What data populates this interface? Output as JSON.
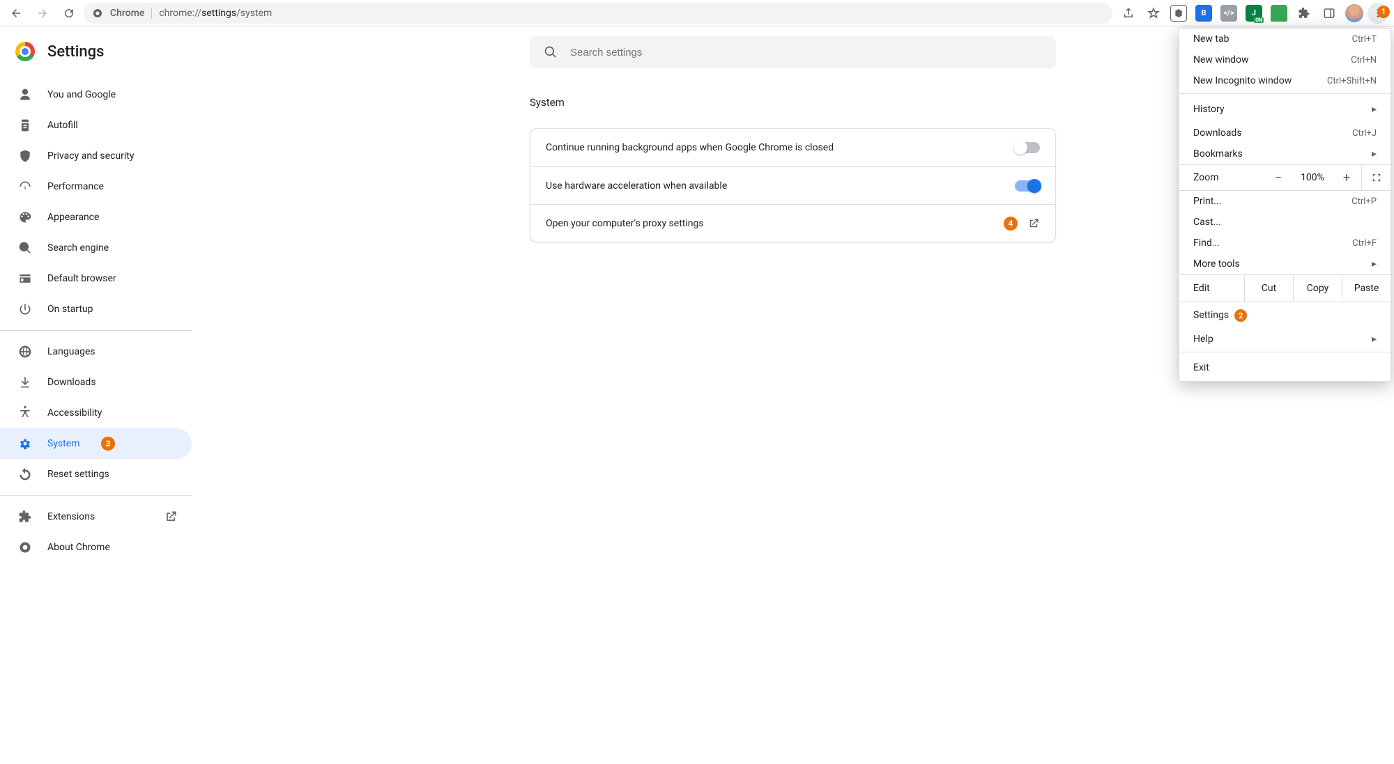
{
  "toolbar": {
    "page_label": "Chrome",
    "url_full": "chrome://settings/system",
    "url_dim_prefix": "chrome://",
    "url_dim_suffix": "/system",
    "url_bold": "settings"
  },
  "kebab_badge": "1",
  "app": {
    "title": "Settings"
  },
  "search": {
    "placeholder": "Search settings"
  },
  "sidebar": {
    "groups": [
      [
        "You and Google",
        "Autofill",
        "Privacy and security",
        "Performance",
        "Appearance",
        "Search engine",
        "Default browser",
        "On startup"
      ],
      [
        "Languages",
        "Downloads",
        "Accessibility",
        "System",
        "Reset settings"
      ],
      [
        "Extensions",
        "About Chrome"
      ]
    ],
    "selected": "System",
    "system_badge": "3"
  },
  "section": {
    "title": "System"
  },
  "rows": {
    "bg_apps": "Continue running background apps when Google Chrome is closed",
    "hw_accel": "Use hardware acceleration when available",
    "proxy": "Open your computer's proxy settings",
    "proxy_badge": "4"
  },
  "menu": {
    "new_tab": "New tab",
    "new_tab_k": "Ctrl+T",
    "new_window": "New window",
    "new_window_k": "Ctrl+N",
    "incognito": "New Incognito window",
    "incognito_k": "Ctrl+Shift+N",
    "history": "History",
    "downloads": "Downloads",
    "downloads_k": "Ctrl+J",
    "bookmarks": "Bookmarks",
    "zoom": "Zoom",
    "zoom_val": "100%",
    "print": "Print...",
    "print_k": "Ctrl+P",
    "cast": "Cast...",
    "find": "Find...",
    "find_k": "Ctrl+F",
    "more_tools": "More tools",
    "edit": "Edit",
    "cut": "Cut",
    "copy": "Copy",
    "paste": "Paste",
    "settings": "Settings",
    "settings_badge": "2",
    "help": "Help",
    "exit": "Exit"
  }
}
